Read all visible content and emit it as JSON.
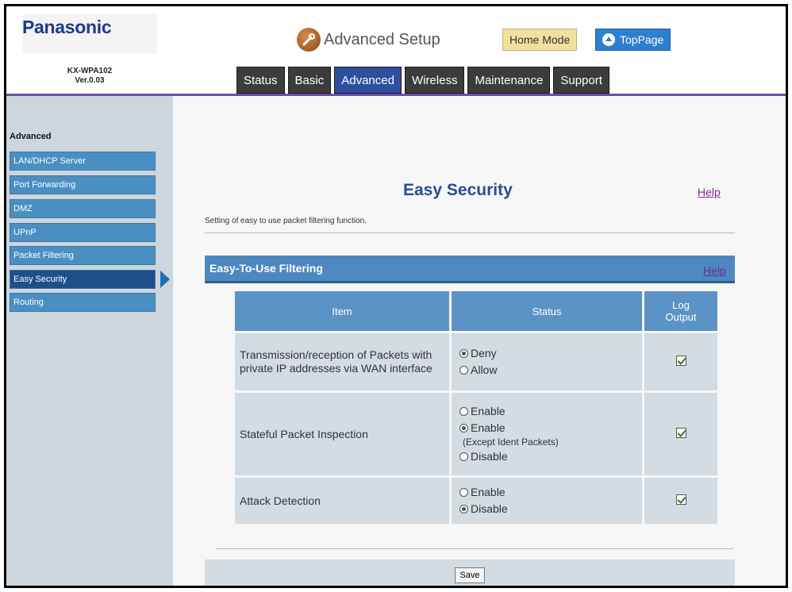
{
  "header": {
    "brand": "Panasonic",
    "model": "KX-WPA102",
    "version": "Ver.0.03",
    "page_heading": "Advanced Setup",
    "mode_button": "Home Mode",
    "top_page_button": "TopPage",
    "tabs": [
      {
        "label": "Status"
      },
      {
        "label": "Basic"
      },
      {
        "label": "Advanced",
        "active": true
      },
      {
        "label": "Wireless"
      },
      {
        "label": "Maintenance"
      },
      {
        "label": "Support"
      }
    ]
  },
  "sidebar": {
    "title": "Advanced",
    "items": [
      {
        "label": "LAN/DHCP Server"
      },
      {
        "label": "Port Forwarding"
      },
      {
        "label": "DMZ"
      },
      {
        "label": "UPnP"
      },
      {
        "label": "Packet Filtering"
      },
      {
        "label": "Easy Security",
        "active": true
      },
      {
        "label": "Routing"
      }
    ]
  },
  "main": {
    "title": "Easy Security",
    "help": "Help",
    "description": "Setting of easy to use packet filtering function.",
    "section": {
      "title": "Easy-To-Use Filtering",
      "help": "Help"
    },
    "table": {
      "headers": [
        "Item",
        "Status",
        "Log Output"
      ],
      "rows": [
        {
          "item": "Transmission/reception of Packets with private IP addresses via WAN interface",
          "options": [
            {
              "label": "Deny",
              "selected": true
            },
            {
              "label": "Allow",
              "selected": false
            }
          ],
          "log_output": true
        },
        {
          "item": "Stateful Packet Inspection",
          "options": [
            {
              "label": "Enable",
              "selected": false
            },
            {
              "label": "Enable",
              "note": "(Except Ident Packets)",
              "selected": true
            },
            {
              "label": "Disable",
              "selected": false
            }
          ],
          "log_output": true
        },
        {
          "item": "Attack Detection",
          "options": [
            {
              "label": "Enable",
              "selected": false
            },
            {
              "label": "Disable",
              "selected": true
            }
          ],
          "log_output": true
        }
      ]
    },
    "save_button": "Save"
  },
  "colors": {
    "brand": "#1a3a8f",
    "tab_active": "#2e4f9e",
    "sidebar_item": "#4a8fc2",
    "sidebar_active": "#1f4f8a",
    "section_bar": "#4e88c0",
    "help_link": "#8b2a9a",
    "header_rule": "#6d4fa3"
  },
  "icons": {
    "page_heading": "wrench-icon",
    "top_page": "up-arrow-icon",
    "active_pointer": "arrow-right-icon"
  }
}
